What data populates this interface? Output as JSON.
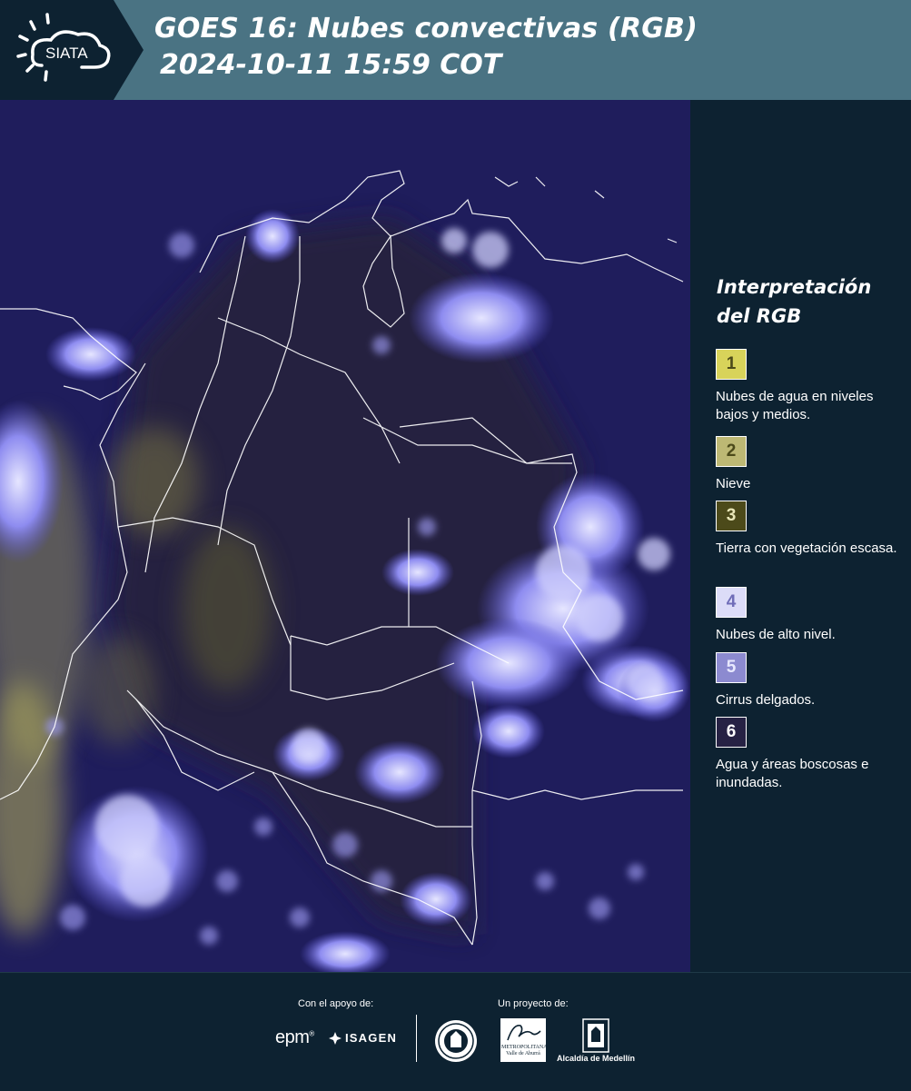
{
  "header": {
    "brand": "SIATA",
    "title_line1": "GOES 16: Nubes convectivas (RGB)",
    "title_line2": "2024-10-11 15:59 COT",
    "background_color": "#4a7383",
    "logo_background_color": "#0d2231"
  },
  "map": {
    "icon": "satellite-rgb-composite-image"
  },
  "legend": {
    "title": "Interpretación del RGB",
    "items": [
      {
        "number": "1",
        "label": "Nubes de agua en niveles bajos y medios.",
        "color": "#d8d35a"
      },
      {
        "number": "2",
        "label": "Nieve",
        "color": "#bdb874"
      },
      {
        "number": "3",
        "label": "Tierra con vegetación escasa.",
        "color": "#4c4a1a"
      },
      {
        "number": "4",
        "label": "Nubes de alto nivel.",
        "color": "#dcdcf8"
      },
      {
        "number": "5",
        "label": "Cirrus delgados.",
        "color": "#8c8ad0"
      },
      {
        "number": "6",
        "label": "Agua y áreas boscosas e inundadas.",
        "color": "#262244"
      }
    ]
  },
  "footer": {
    "support_label": "Con el apoyo de:",
    "project_label": "Un proyecto de:",
    "sponsor_1": "epm",
    "sponsor_2": "ISAGEN",
    "partner_area": "METROPOLITANA Valle de Aburrá",
    "partner_alcaldia": "Alcaldía de Medellín"
  }
}
